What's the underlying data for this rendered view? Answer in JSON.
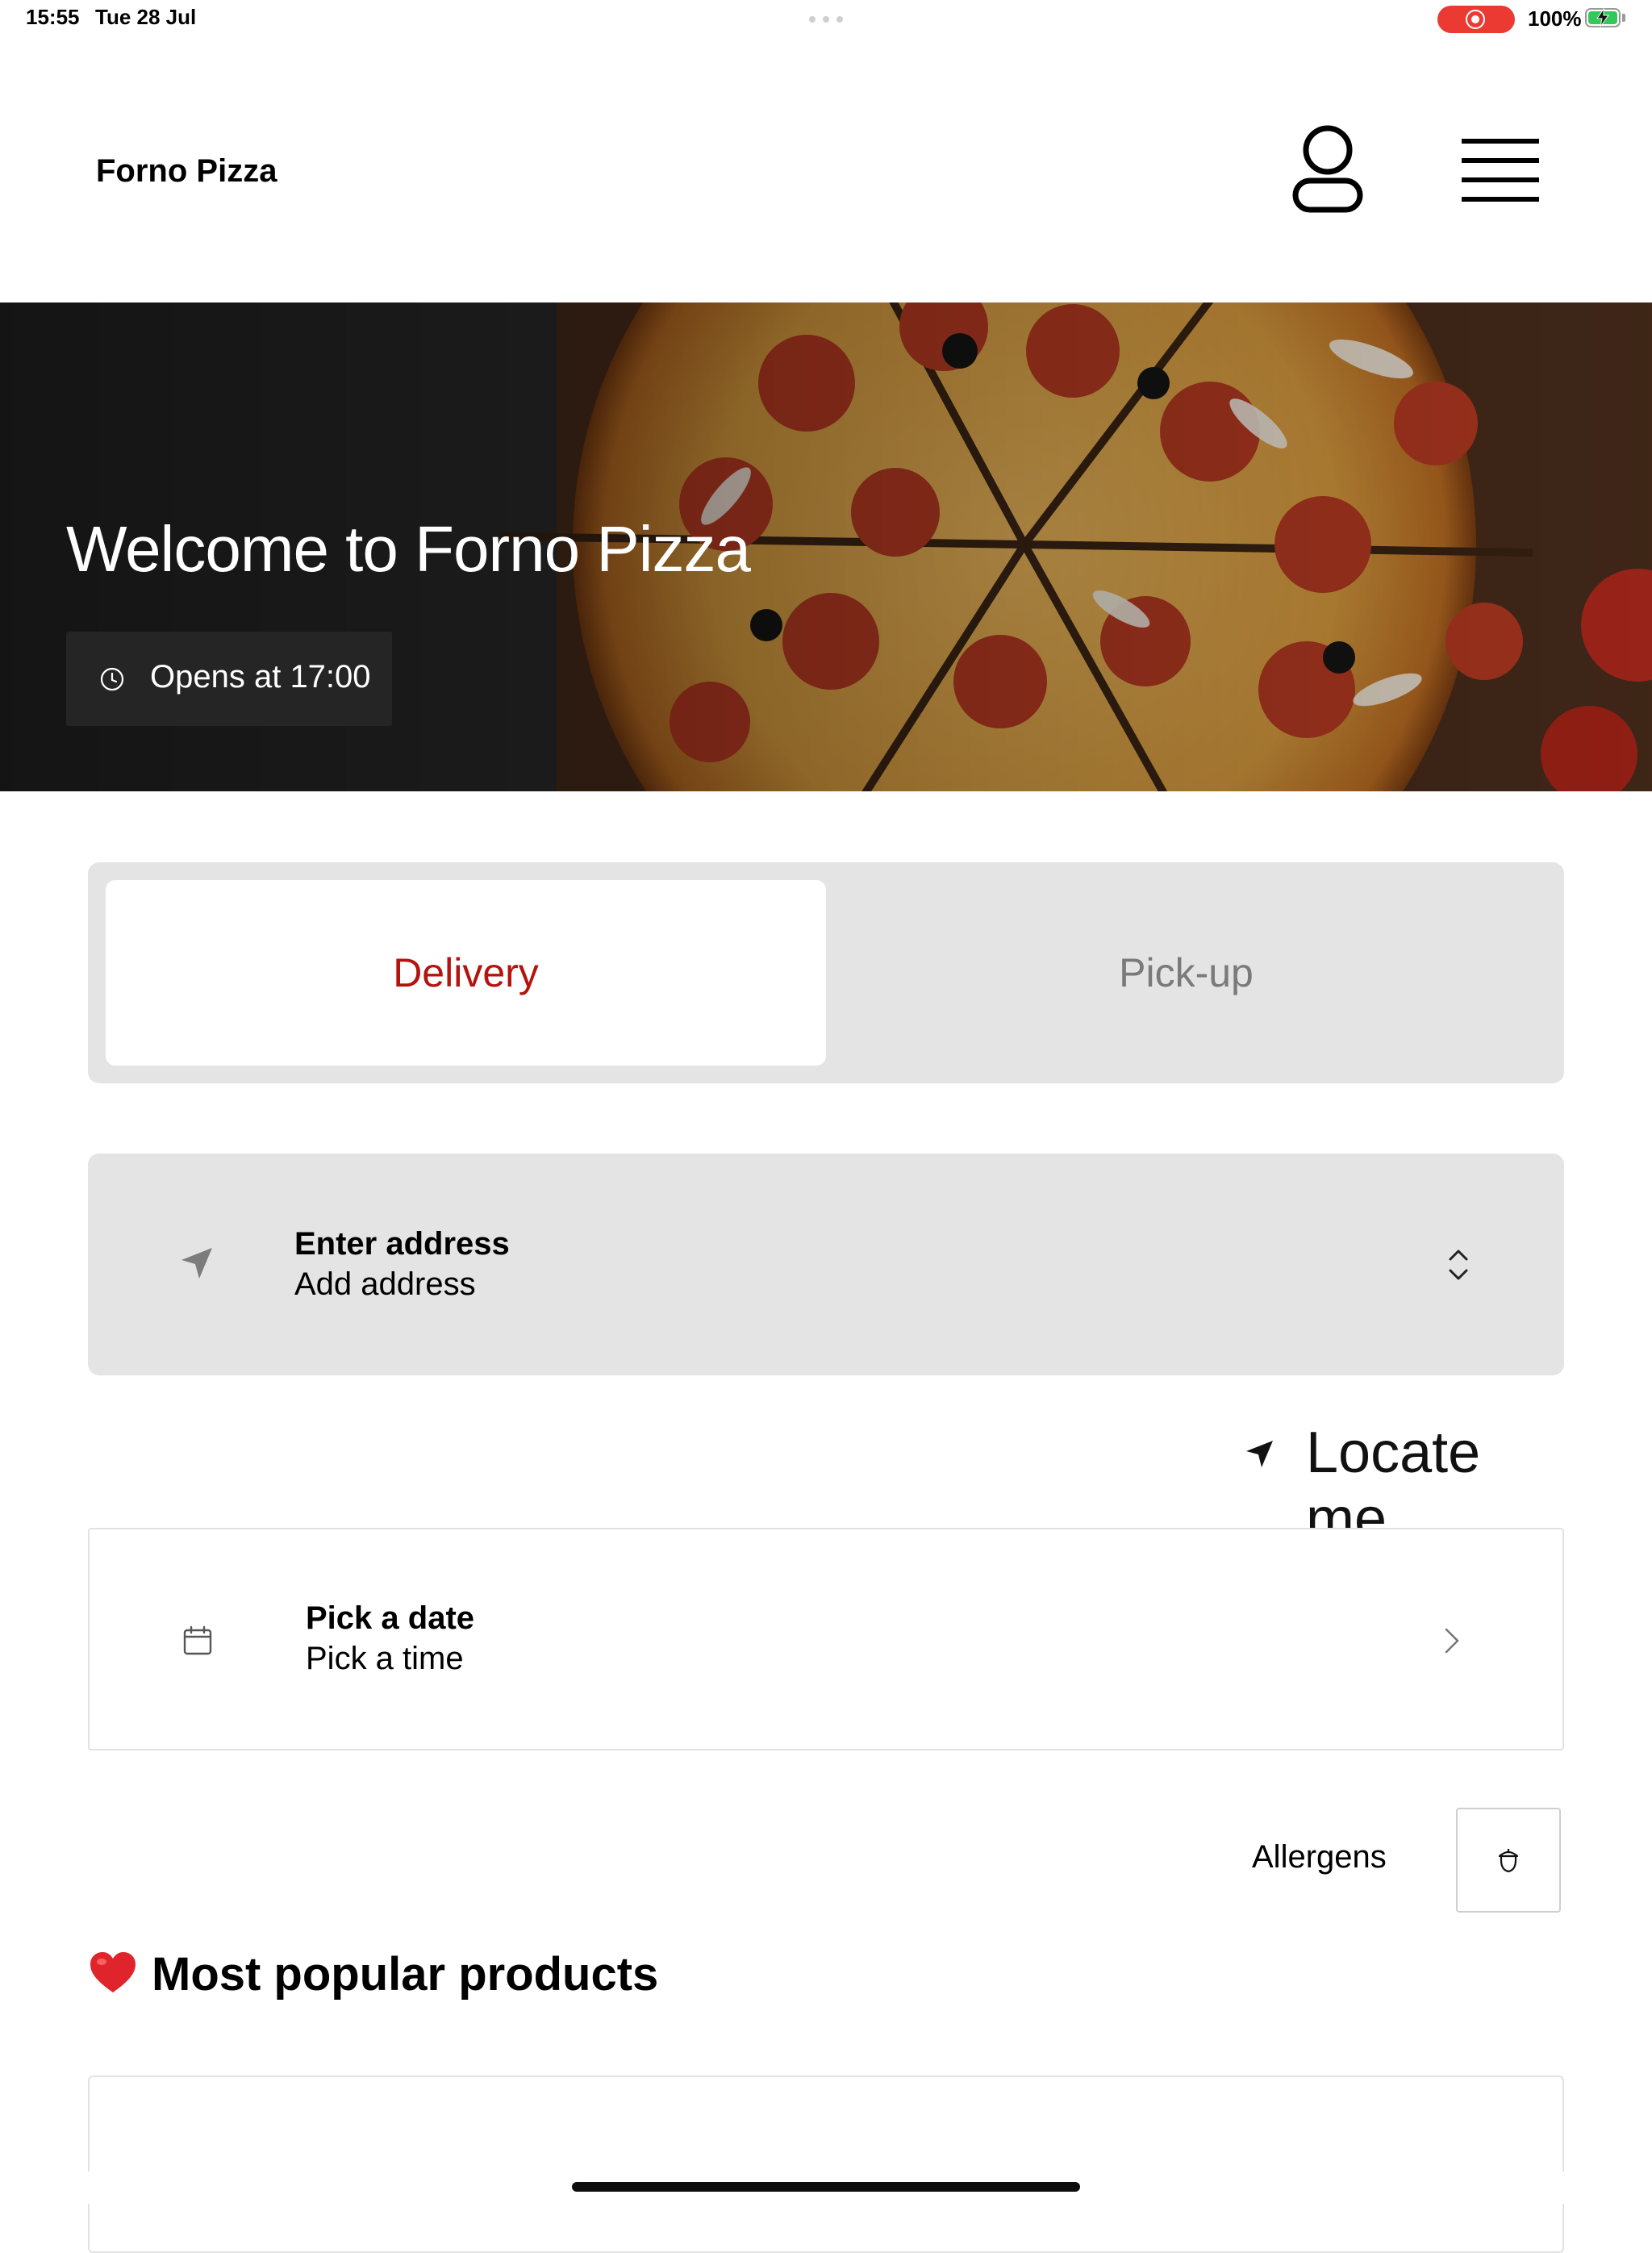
{
  "status_bar": {
    "time": "15:55",
    "date": "Tue 28 Jul",
    "battery": "100%"
  },
  "header": {
    "brand": "Forno Pizza",
    "profile_icon": "person-icon",
    "menu_icon": "hamburger-menu-icon"
  },
  "hero": {
    "title": "Welcome to Forno Pizza",
    "opens": "Opens at 17:00",
    "opens_icon": "clock-icon"
  },
  "order_type": {
    "options": [
      "Delivery",
      "Pick-up"
    ],
    "selected": "Delivery",
    "accent_color": "#b3140d"
  },
  "address": {
    "title": "Enter address",
    "subtitle": "Add address",
    "icon": "location-arrow-icon"
  },
  "locate": {
    "label": "Locate me"
  },
  "schedule": {
    "title": "Pick a date",
    "subtitle": "Pick a time",
    "icon": "calendar-icon"
  },
  "allergens": {
    "label": "Allergens",
    "icon": "acorn-icon"
  },
  "popular": {
    "title": "Most popular products",
    "icon": "heart-icon"
  }
}
